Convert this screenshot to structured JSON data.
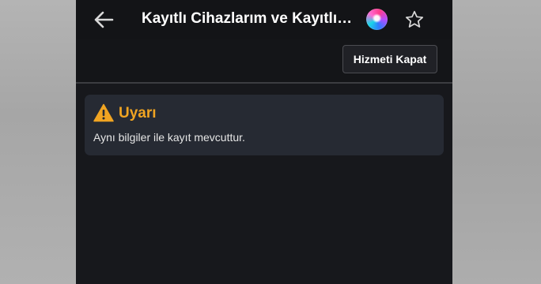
{
  "header": {
    "title": "Kayıtlı Cihazlarım ve Kayıtlı Kartlarım",
    "back_icon": "arrow-left-icon",
    "assistant_icon": "siri-icon",
    "favorite_icon": "star-outline-icon"
  },
  "toolbar": {
    "action_label": "Hizmeti Kapat"
  },
  "alert": {
    "icon": "warning-triangle-icon",
    "title": "Uyarı",
    "message": "Aynı bilgiler ile kayıt mevcuttur."
  },
  "colors": {
    "background": "#17181c",
    "alert_background": "#262a33",
    "warning": "#f0a422"
  }
}
